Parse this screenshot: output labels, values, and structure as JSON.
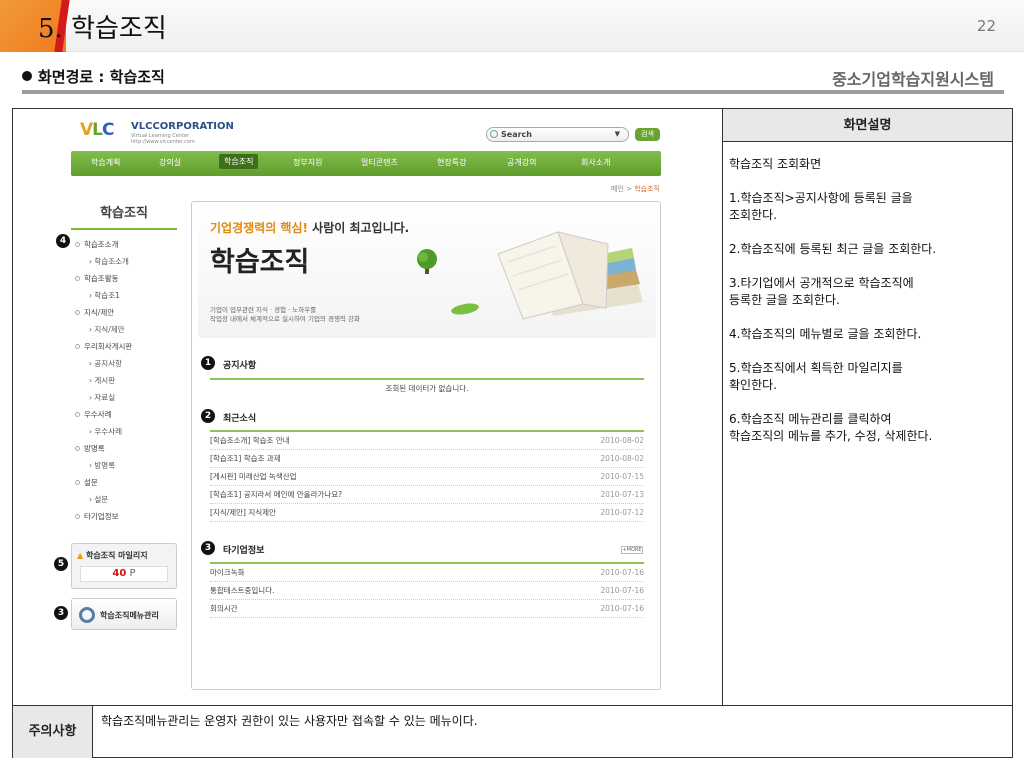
{
  "slide": {
    "title": "5. 학습조직",
    "number": "22",
    "path": "화면경로 : 학습조직",
    "system_name": "중소기업학습지원시스템"
  },
  "description": {
    "header": "화면설명",
    "body": "학습조직 조회화면\n\n1.학습조직>공지사항에 등록된 글을\n 조회한다.\n\n2.학습조직에 등록된 최근 글을 조회한다.\n\n3.타기업에서 공개적으로 학습조직에\n 등록한 글을 조회한다.\n\n4.학습조직의 메뉴별로 글을 조회한다.\n\n5.학습조직에서 획득한 마일리지를\n 확인한다.\n\n6.학습조직 메뉴관리를 클릭하여\n 학습조직의 메뉴를 추가, 수정, 삭제한다."
  },
  "note": {
    "label": "주의사항",
    "text": "학습조직메뉴관리는 운영자 권한이 있는 사용자만 접속할 수 있는 메뉴이다."
  },
  "site": {
    "logo": {
      "v": "V",
      "l": "L",
      "c": "C"
    },
    "corp_name": "VLCCORPORATION",
    "corp_sub": "Virtual Learning Center\nhttp://www.vlccenter.com",
    "search_placeholder": "Search",
    "search_button": "검색",
    "gnb": [
      "학습계획",
      "강의실",
      "학습조직",
      "정부지원",
      "멀티콘텐츠",
      "현장특강",
      "공개강의",
      "회사소개"
    ],
    "breadcrumb": {
      "home": "메인 >",
      "current": "학습조직"
    },
    "lnb_title": "학습조직",
    "lnb": [
      {
        "label": "학습조소개",
        "sub": false
      },
      {
        "label": "학습조소개",
        "sub": true
      },
      {
        "label": "학습조활동",
        "sub": false
      },
      {
        "label": "학습조1",
        "sub": true
      },
      {
        "label": "지식/제안",
        "sub": false
      },
      {
        "label": "지식/제안",
        "sub": true
      },
      {
        "label": "우리회사게시판",
        "sub": false
      },
      {
        "label": "공지사항",
        "sub": true
      },
      {
        "label": "게시판",
        "sub": true
      },
      {
        "label": "자료실",
        "sub": true
      },
      {
        "label": "우수사례",
        "sub": false
      },
      {
        "label": "우수사례",
        "sub": true
      },
      {
        "label": "방명록",
        "sub": false
      },
      {
        "label": "방명록",
        "sub": true
      },
      {
        "label": "설문",
        "sub": false
      },
      {
        "label": "설문",
        "sub": true
      },
      {
        "label": "타기업정보",
        "sub": false
      }
    ],
    "mileage_title": "학습조직 마일리지",
    "mileage_value": "40",
    "mileage_unit": "P",
    "menu_manage": "학습조직메뉴관리",
    "banner": {
      "highlight": "기업경쟁력의 핵심!",
      "rest": " 사람이 최고입니다.",
      "big": "학습조직",
      "small": "기업이 업무관련 지식 · 경험 · 노하우를\n작업장 내에서 체계적으로 실시하여 기업의 경쟁력 강화"
    },
    "notice_title": "공지사항",
    "notice_empty": "조회된 데이터가 없습니다.",
    "recent_title": "최근소식",
    "recent": [
      {
        "title": "[학습조소개] 학습조 안내",
        "date": "2010-08-02"
      },
      {
        "title": "[학습조1] 학습조 과제",
        "date": "2010-08-02"
      },
      {
        "title": "[게시판] 미래산업 녹색산업",
        "date": "2010-07-15"
      },
      {
        "title": "[학습조1] 공지라서 메인에 안올라가나요?",
        "date": "2010-07-13"
      },
      {
        "title": "[지식/제안] 지식제안",
        "date": "2010-07-12"
      }
    ],
    "other_title": "타기업정보",
    "more": "+MORE",
    "other": [
      {
        "title": "마이크녹화",
        "date": "2010-07-16"
      },
      {
        "title": "통합테스트중입니다.",
        "date": "2010-07-16"
      },
      {
        "title": "회의시간",
        "date": "2010-07-16"
      }
    ],
    "badges": [
      "1",
      "2",
      "3",
      "4",
      "5",
      "3"
    ]
  }
}
